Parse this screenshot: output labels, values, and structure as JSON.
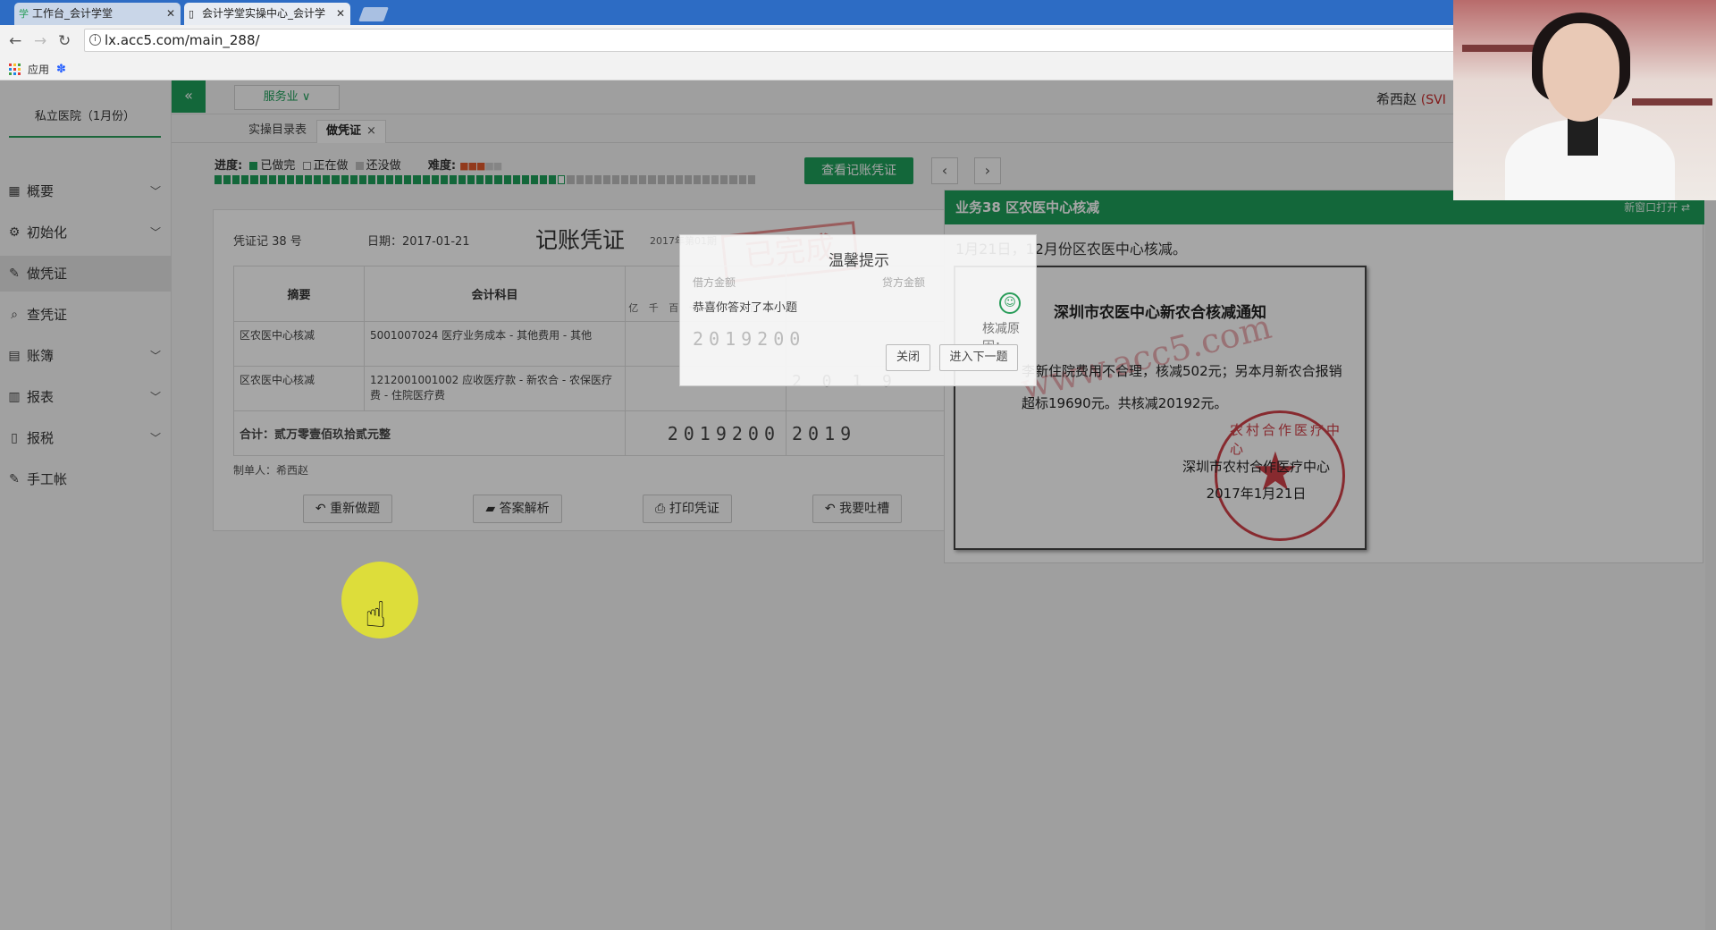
{
  "browser": {
    "tabs": [
      {
        "label": "工作台_会计学堂",
        "icon": "school-icon"
      },
      {
        "label": "会计学堂实操中心_会计学",
        "icon": "page-icon"
      }
    ],
    "url": "lx.acc5.com/main_288/",
    "bookmarks_apps": "应用"
  },
  "sidebar": {
    "org": "私立医院（1月份）",
    "items": [
      {
        "label": "概要",
        "icon": "grid-icon",
        "chevron": true
      },
      {
        "label": "初始化",
        "icon": "gear-icon",
        "chevron": true
      },
      {
        "label": "做凭证",
        "icon": "pen-icon",
        "chevron": false,
        "active": true
      },
      {
        "label": "查凭证",
        "icon": "search-icon",
        "chevron": false
      },
      {
        "label": "账簿",
        "icon": "book-icon",
        "chevron": true
      },
      {
        "label": "报表",
        "icon": "report-icon",
        "chevron": true
      },
      {
        "label": "报税",
        "icon": "file-icon",
        "chevron": true
      },
      {
        "label": "手工帐",
        "icon": "pen-icon",
        "chevron": false
      }
    ]
  },
  "topbar": {
    "industry": "服务业",
    "user": "希西赵",
    "user_suffix": "(SVI"
  },
  "subtabs": [
    {
      "label": "实操目录表"
    },
    {
      "label": "做凭证",
      "close": "×"
    }
  ],
  "progress": {
    "label": "进度:",
    "done": "已做完",
    "doing": "正在做",
    "todo": "还没做",
    "difficulty": "难度:",
    "difficulty_stars": 3,
    "difficulty_max": 5,
    "done_count": 38,
    "total_count": 60,
    "colors": {
      "done": "#1e9e5a",
      "doing": "#ffffff",
      "todo": "#bdbdbd"
    }
  },
  "view_voucher_btn": "查看记账凭证",
  "voucher": {
    "number": "凭证记 38 号",
    "date": "日期：2017-01-21",
    "title": "记账凭证",
    "period": "2017年第01期",
    "stamp": "已完成",
    "headers": {
      "summary": "摘要",
      "account": "会计科目",
      "debit": "借方金额",
      "credit": "贷方金额"
    },
    "units": "亿 千 百 十 万 千 百 十",
    "rows": [
      {
        "summary": "区农医中心核减",
        "account": "5001007024 医疗业务成本 - 其他费用 - 其他",
        "debit": "",
        "credit": ""
      },
      {
        "summary": "区农医中心核减",
        "account": "1212001001002 应收医疗款 - 新农合 - 农保医疗费 - 住院医疗费",
        "debit": "",
        "credit": "2 0 1 9"
      }
    ],
    "total_label": "合计：贰万零壹佰玖拾贰元整",
    "total_debit": "2019200",
    "total_credit": "2019",
    "maker": "制单人：希西赵",
    "buttons": [
      "重新做题",
      "答案解析",
      "打印凭证",
      "我要吐槽"
    ]
  },
  "task": {
    "title": "业务38 区农医中心核减",
    "open_new": "新窗口打开",
    "desc": "1月21日，12月份区农医中心核减。",
    "reason_label": "核减原因：",
    "notice_title": "深圳市农医中心新农合核减通知",
    "notice_body": "李新住院费用不合理，核减502元；另本月新农合报销超标19690元。共核减20192元。",
    "notice_org": "深圳市农村合作医疗中心",
    "notice_date": "2017年1月21日",
    "seal_text": "农村合作医疗中心",
    "watermark": "www.acc5.com"
  },
  "dialog": {
    "title": "温馨提示",
    "message": "恭喜你答对了本小题",
    "close": "关闭",
    "next": "进入下一题",
    "debit_label": "借方金额",
    "credit_label": "贷方金额",
    "amount": "2019200"
  }
}
